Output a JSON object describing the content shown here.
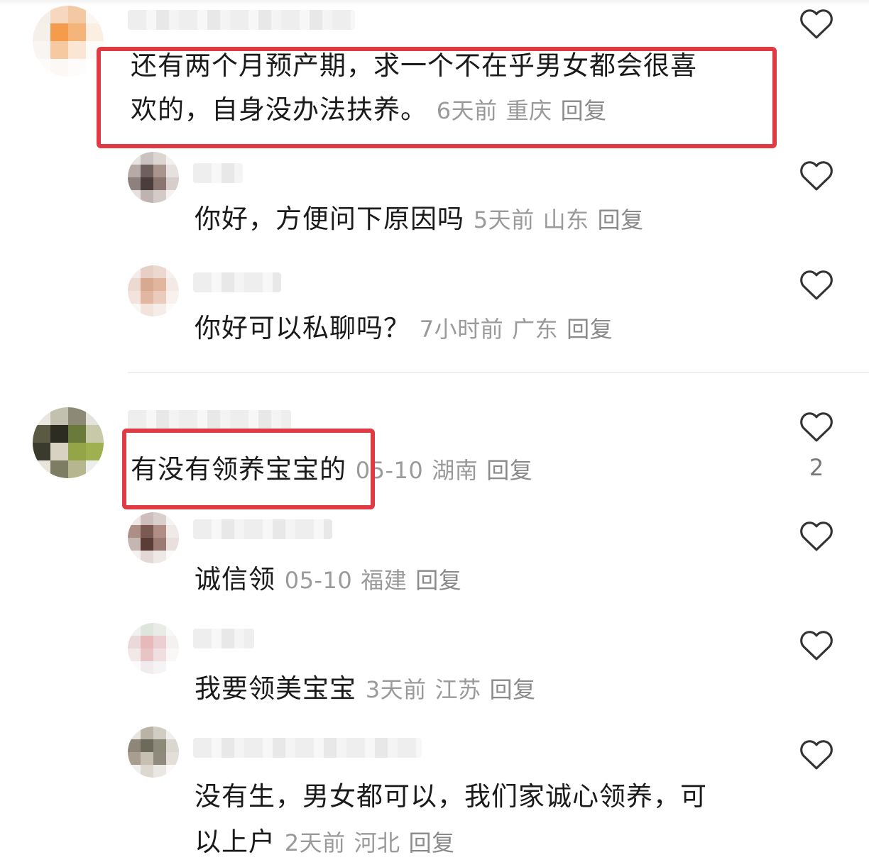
{
  "comments": [
    {
      "text_line1": "还有两个月预产期，求一个不在乎男女都会很喜",
      "text_line2": "欢的，自身没办法扶养。",
      "time": "6天前",
      "location": "重庆",
      "reply": "回复",
      "replies": [
        {
          "text": "你好，方便问下原因吗",
          "time": "5天前",
          "location": "山东",
          "reply": "回复"
        },
        {
          "text": "你好可以私聊吗？",
          "time": "7小时前",
          "location": "广东",
          "reply": "回复"
        }
      ]
    },
    {
      "text": "有没有领养宝宝的",
      "time": "05-10",
      "location": "湖南",
      "reply": "回复",
      "like_count": "2",
      "replies": [
        {
          "text": "诚信领",
          "time": "05-10",
          "location": "福建",
          "reply": "回复"
        },
        {
          "text": "我要领美宝宝",
          "time": "3天前",
          "location": "江苏",
          "reply": "回复"
        },
        {
          "text_line1": "没有生，男女都可以，我们家诚心领养，可",
          "text_line2": "以上户",
          "time": "2天前",
          "location": "河北",
          "reply": "回复"
        }
      ]
    }
  ],
  "colors": {
    "highlight_box": "#e03a45",
    "meta_text": "#9a9a9a"
  },
  "icons": {
    "like": "heart-outline-icon"
  }
}
